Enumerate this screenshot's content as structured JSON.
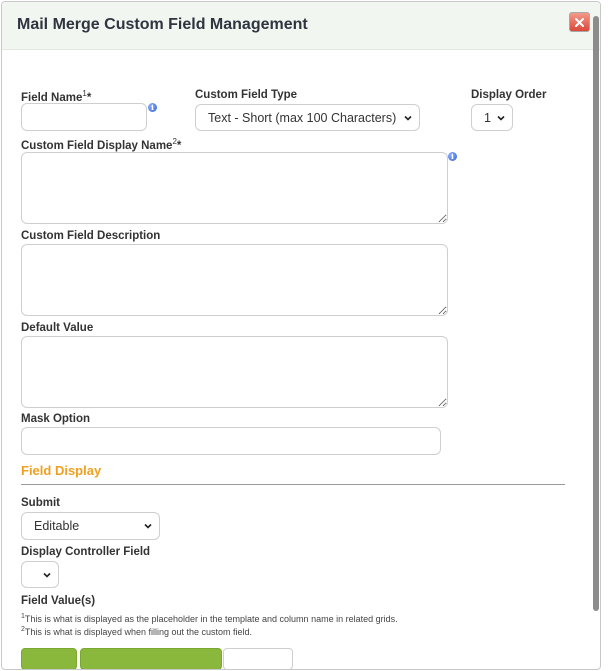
{
  "dialog": {
    "title": "Mail Merge Custom Field Management"
  },
  "form": {
    "field_name": {
      "label": "Field Name",
      "sup": "1",
      "required": "*",
      "value": ""
    },
    "custom_field_type": {
      "label": "Custom Field Type",
      "value": "Text - Short (max 100 Characters)"
    },
    "display_order": {
      "label": "Display Order",
      "value": "1"
    },
    "display_name": {
      "label": "Custom Field Display Name",
      "sup": "2",
      "required": "*",
      "value": ""
    },
    "description": {
      "label": "Custom Field Description",
      "value": ""
    },
    "default_value": {
      "label": "Default Value",
      "value": ""
    },
    "mask_option": {
      "label": "Mask Option",
      "value": ""
    }
  },
  "field_display": {
    "section_title": "Field Display",
    "submit": {
      "label": "Submit",
      "value": "Editable"
    },
    "controller": {
      "label": "Display Controller Field",
      "value": ""
    },
    "field_values_label": "Field Value(s)"
  },
  "footnotes": [
    {
      "num": "1",
      "text": "This is what is displayed as the placeholder in the template and column name in related grids."
    },
    {
      "num": "2",
      "text": "This is what is displayed when filling out the custom field."
    }
  ],
  "colors": {
    "accent": "#f0a020",
    "button_green": "#8ab83c",
    "close_red": "#d9493a"
  }
}
